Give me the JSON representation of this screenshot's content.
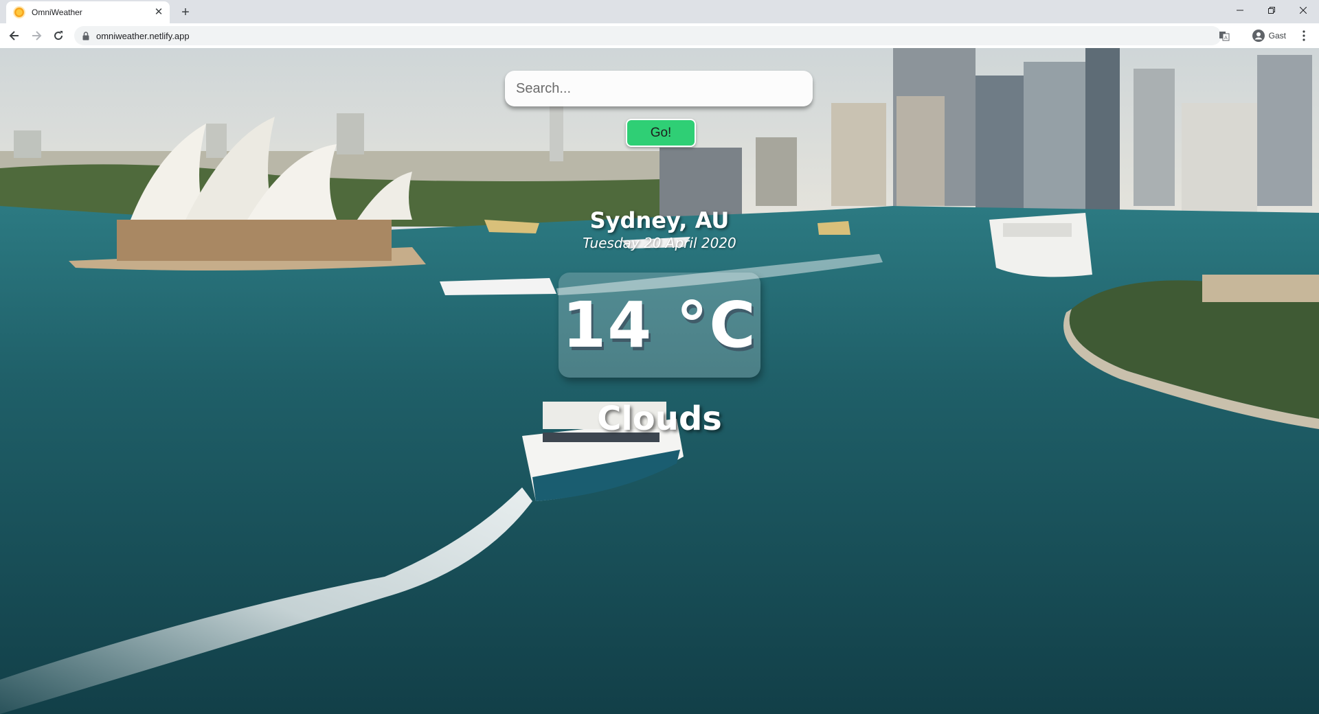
{
  "browser": {
    "tab_title": "OmniWeather",
    "url": "omniweather.netlify.app",
    "profile_label": "Gast",
    "icons": {
      "favicon": "sun-icon",
      "close": "close-icon",
      "new_tab": "plus-icon",
      "back": "back-arrow-icon",
      "forward": "forward-arrow-icon",
      "reload": "reload-icon",
      "lock": "lock-icon",
      "translate": "translate-icon",
      "profile": "avatar-icon",
      "menu": "kebab-menu-icon"
    }
  },
  "search": {
    "placeholder": "Search...",
    "value": "",
    "button_label": "Go!",
    "button_color": "#2fcf75"
  },
  "weather": {
    "location": "Sydney, AU",
    "date": "Tuesday 20 April 2020",
    "temperature": "14 °C",
    "condition": "Clouds"
  },
  "background": {
    "description_icon": "harbour-photo",
    "water_color": "#1d5560",
    "sky_color": "#d8dee0"
  }
}
